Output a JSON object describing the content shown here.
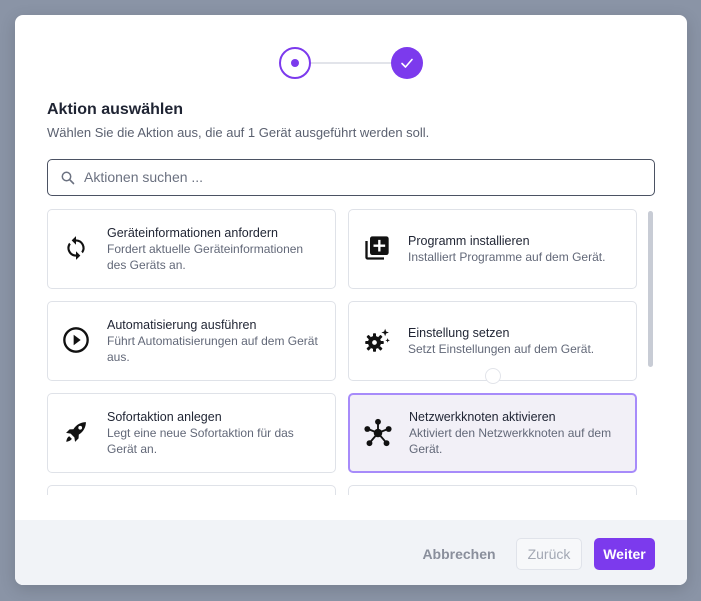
{
  "stepper": {
    "step1": "current",
    "step2": "completed"
  },
  "header": {
    "title": "Aktion auswählen",
    "subtitle": "Wählen Sie die Aktion aus, die auf 1 Gerät ausgeführt werden soll."
  },
  "search": {
    "placeholder": "Aktionen suchen ...",
    "value": ""
  },
  "actions": [
    {
      "title": "Geräteinformationen anfordern",
      "desc": "Fordert aktuelle Geräteinformationen des Geräts an.",
      "icon": "refresh-icon"
    },
    {
      "title": "Programm installieren",
      "desc": "Installiert Programme auf dem Gerät.",
      "icon": "add-library-icon"
    },
    {
      "title": "Automatisierung ausführen",
      "desc": "Führt Automatisierungen auf dem Gerät aus.",
      "icon": "play-circle-icon"
    },
    {
      "title": "Einstellung setzen",
      "desc": "Setzt Einstellungen auf dem Gerät.",
      "icon": "settings-sparkle-icon"
    },
    {
      "title": "Sofortaktion anlegen",
      "desc": "Legt eine neue Sofortaktion für das Gerät an.",
      "icon": "rocket-icon"
    },
    {
      "title": "Netzwerkknoten aktivieren",
      "desc": "Aktiviert den Netzwerkknoten auf dem Gerät.",
      "icon": "network-hub-icon",
      "selected": true
    }
  ],
  "footer": {
    "cancel_label": "Abbrechen",
    "back_label": "Zurück",
    "next_label": "Weiter"
  },
  "colors": {
    "accent": "#7c3aed",
    "selected_border": "#a78bfa",
    "selected_bg": "#f2f0f7"
  }
}
